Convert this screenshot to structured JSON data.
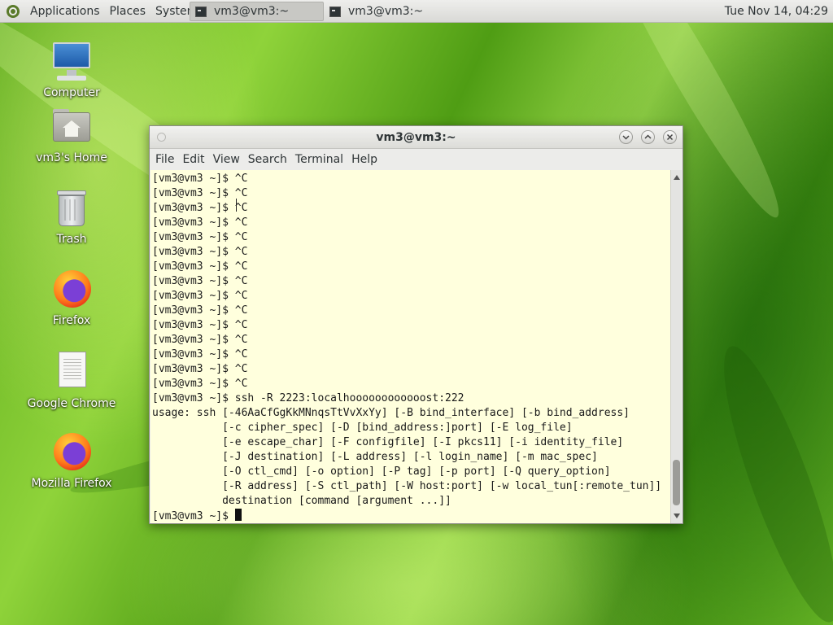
{
  "top_panel": {
    "menus": [
      "Applications",
      "Places",
      "System"
    ],
    "taskbar": [
      {
        "label": "vm3@vm3:~",
        "active": true
      },
      {
        "label": "vm3@vm3:~",
        "active": false
      }
    ],
    "clock": "Tue Nov 14, 04:29"
  },
  "desktop_icons": [
    {
      "label": "Computer",
      "icon": "computer-icon"
    },
    {
      "label": "vm3's Home",
      "icon": "home-folder-icon"
    },
    {
      "label": "Trash",
      "icon": "trash-icon"
    },
    {
      "label": "Firefox",
      "icon": "firefox-icon"
    },
    {
      "label": "Google Chrome",
      "icon": "document-icon"
    },
    {
      "label": "Mozilla Firefox",
      "icon": "firefox-icon"
    }
  ],
  "terminal": {
    "title": "vm3@vm3:~",
    "menu": [
      "File",
      "Edit",
      "View",
      "Search",
      "Terminal",
      "Help"
    ],
    "lines": [
      "[vm3@vm3 ~]$ ^C",
      "[vm3@vm3 ~]$ ^C",
      "[vm3@vm3 ~]$ ^C",
      "[vm3@vm3 ~]$ ^C",
      "[vm3@vm3 ~]$ ^C",
      "[vm3@vm3 ~]$ ^C",
      "[vm3@vm3 ~]$ ^C",
      "[vm3@vm3 ~]$ ^C",
      "[vm3@vm3 ~]$ ^C",
      "[vm3@vm3 ~]$ ^C",
      "[vm3@vm3 ~]$ ^C",
      "[vm3@vm3 ~]$ ^C",
      "[vm3@vm3 ~]$ ^C",
      "[vm3@vm3 ~]$ ^C",
      "[vm3@vm3 ~]$ ^C",
      "[vm3@vm3 ~]$ ssh -R 2223:localhoooooooooooost:222",
      "usage: ssh [-46AaCfGgKkMNnqsTtVvXxYy] [-B bind_interface] [-b bind_address]",
      "           [-c cipher_spec] [-D [bind_address:]port] [-E log_file]",
      "           [-e escape_char] [-F configfile] [-I pkcs11] [-i identity_file]",
      "           [-J destination] [-L address] [-l login_name] [-m mac_spec]",
      "           [-O ctl_cmd] [-o option] [-P tag] [-p port] [-Q query_option]",
      "           [-R address] [-S ctl_path] [-W host:port] [-w local_tun[:remote_tun]]",
      "           destination [command [argument ...]]"
    ],
    "prompt": "[vm3@vm3 ~]$ "
  }
}
